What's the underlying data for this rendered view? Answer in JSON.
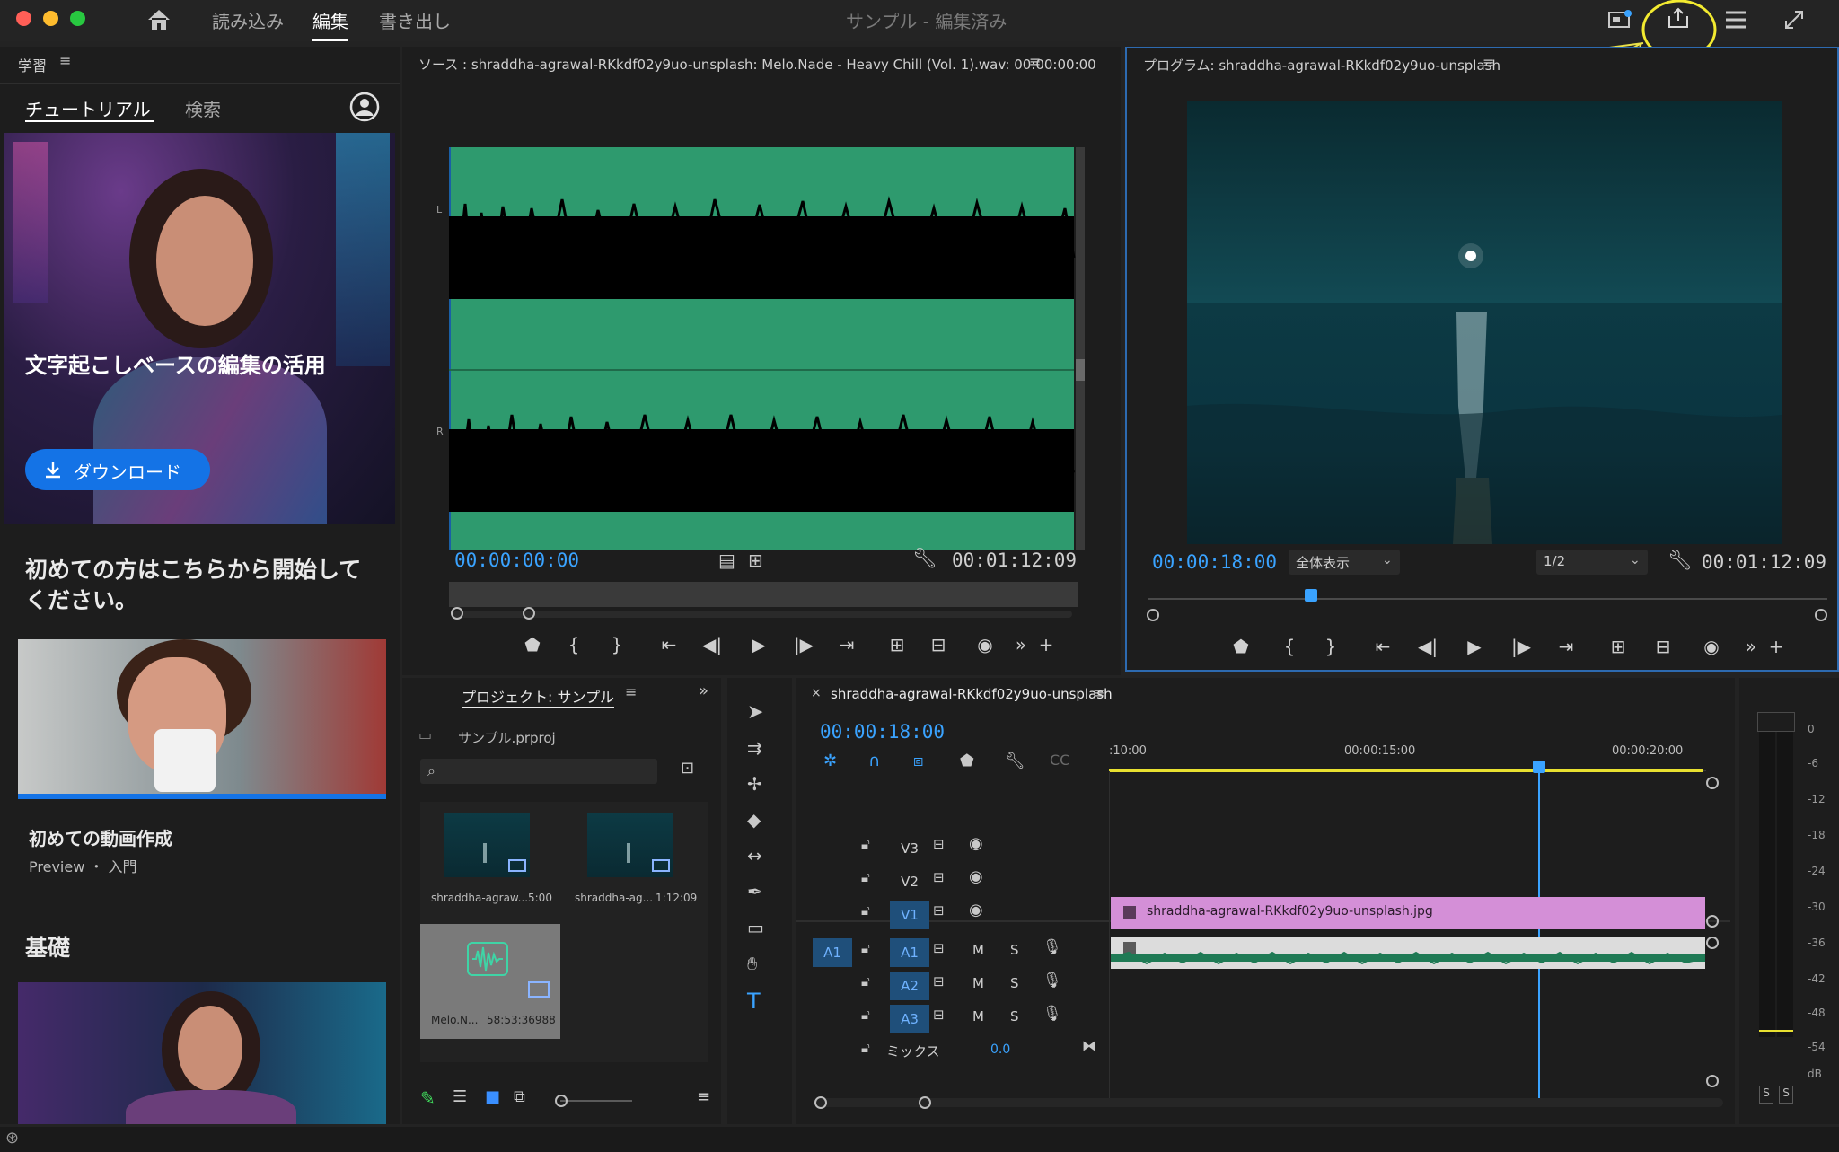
{
  "window": {
    "title": "サンプル - 編集済み",
    "nav": [
      "読み込み",
      "編集",
      "書き出し"
    ],
    "active_nav": "編集"
  },
  "learn_panel": {
    "title": "学習",
    "tabs": [
      "チュートリアル",
      "検索"
    ],
    "hero_title": "文字起こしベースの編集の活用",
    "download_label": "ダウンロード",
    "section_start": "初めての方はこちらから開始してください。",
    "card_title": "初めての動画作成",
    "card_meta": "Preview ・ 入門",
    "section_basics": "基礎"
  },
  "source_monitor": {
    "title": "ソース : shraddha-agrawal-RKkdf02y9uo-unsplash: Melo.Nade - Heavy Chill (Vol. 1).wav: 00:00:00:00",
    "channel_top": "L",
    "channel_bottom": "R",
    "timecode_in": "00:00:00:00",
    "timecode_dur": "00:01:12:09"
  },
  "program_monitor": {
    "title": "プログラム: shraddha-agrawal-RKkdf02y9uo-unsplash",
    "timecode_in": "00:00:18:00",
    "zoom": "全体表示",
    "resolution": "1/2",
    "timecode_dur": "00:01:12:09"
  },
  "project_panel": {
    "title": "プロジェクト: サンプル",
    "file": "サンプル.prproj",
    "search_placeholder": "",
    "items": [
      {
        "name": "shraddha-agraw...",
        "duration": "5:00"
      },
      {
        "name": "shraddha-ag...",
        "duration": "1:12:09"
      },
      {
        "name": "Melo.N...",
        "duration": "58:53:36988"
      }
    ]
  },
  "timeline": {
    "title": "shraddha-agrawal-RKkdf02y9uo-unsplash",
    "timecode": "00:00:18:00",
    "ruler": [
      ":10:00",
      "00:00:15:00",
      "00:00:20:00"
    ],
    "video_tracks": [
      "V3",
      "V2",
      "V1"
    ],
    "audio_tracks": [
      "A1",
      "A2",
      "A3"
    ],
    "source_patch": "A1",
    "mix_label": "ミックス",
    "mix_value": "0.0",
    "mute": "M",
    "solo": "S",
    "video_clip": "shraddha-agrawal-RKkdf02y9uo-unsplash.jpg"
  },
  "audio_meter": {
    "scale": [
      "0",
      "-6",
      "-12",
      "-18",
      "-24",
      "-30",
      "-36",
      "-42",
      "-48",
      "-54",
      "dB"
    ],
    "solo_left": "S",
    "solo_right": "S"
  },
  "colors": {
    "accent": "#3aa3ff",
    "waveform_bg": "#2e9a6e",
    "video_clip": "#d48fd7",
    "annotation": "#f2ea30"
  }
}
